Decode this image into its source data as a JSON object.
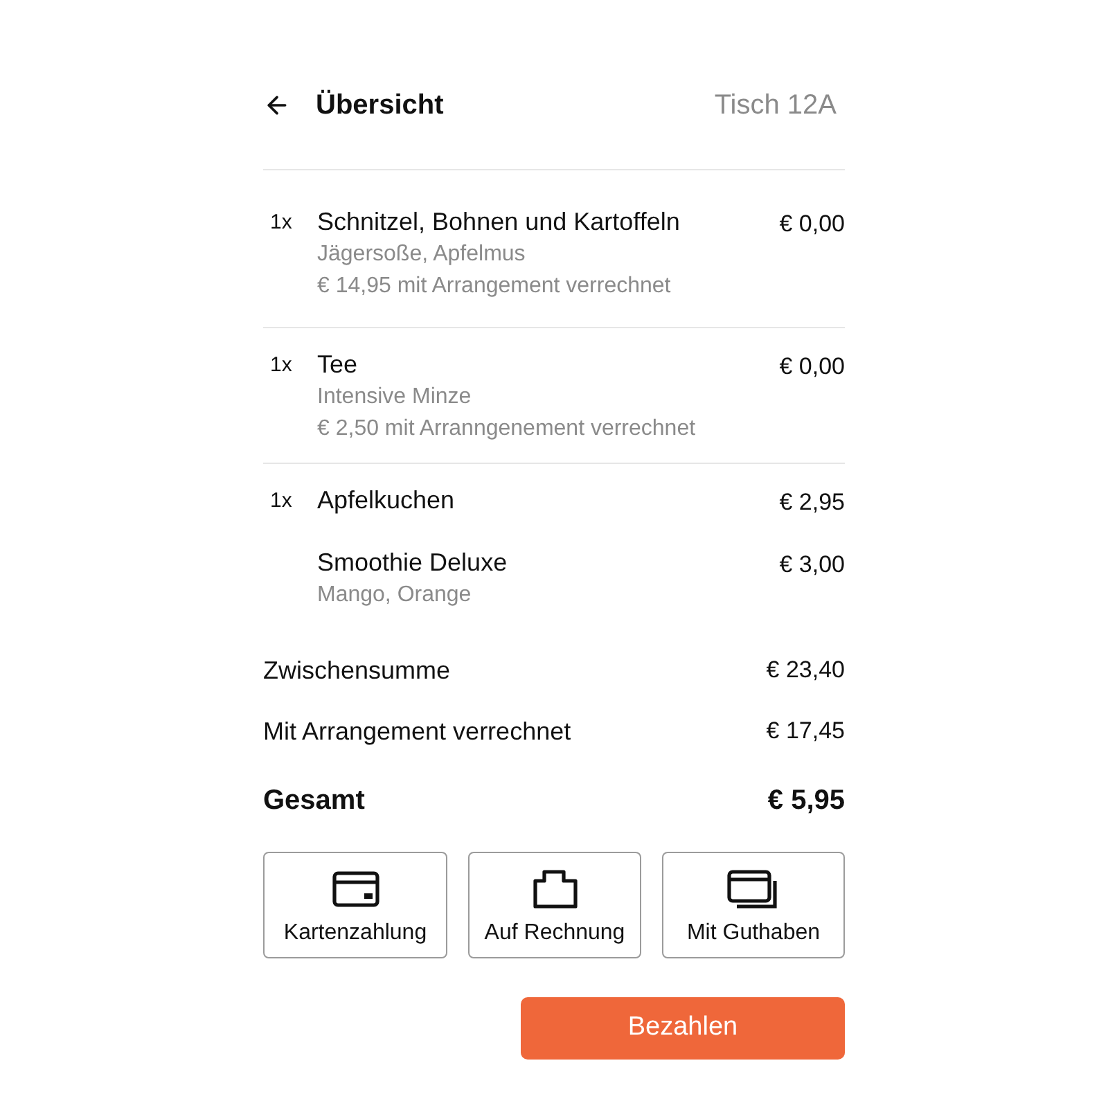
{
  "header": {
    "title": "Übersicht",
    "table": "Tisch 12A"
  },
  "groups": [
    {
      "lines": [
        {
          "qty": "1x",
          "name": "Schnitzel, Bohnen und Kartoffeln",
          "price": "€ 0,00",
          "details": [
            "Jägersoße, Apfelmus",
            "€ 14,95 mit Arrangement verrechnet"
          ]
        }
      ]
    },
    {
      "lines": [
        {
          "qty": "1x",
          "name": "Tee",
          "price": "€ 0,00",
          "details": [
            "Intensive Minze",
            "€ 2,50 mit Arranngenement verrechnet"
          ]
        }
      ]
    },
    {
      "lines": [
        {
          "qty": "1x",
          "name": "Apfelkuchen",
          "price": "€ 2,95"
        },
        {
          "name": "Smoothie Deluxe",
          "price": "€ 3,00",
          "details": [
            "Mango, Orange"
          ]
        }
      ]
    }
  ],
  "totals": [
    {
      "kind": "subtotal",
      "label": "Zwischensumme",
      "amount": "€ 23,40"
    },
    {
      "kind": "subtotal",
      "label": "Mit Arrangement verrechnet",
      "amount": "€ 17,45"
    },
    {
      "kind": "total",
      "label": "Gesamt",
      "amount": "€ 5,95"
    }
  ],
  "payment_options": [
    {
      "kind": "card",
      "label": "Kartenzahlung",
      "selected": false
    },
    {
      "kind": "invoice",
      "label": "Auf Rechnung",
      "selected": false
    },
    {
      "kind": "credit",
      "label": "Mit Guthaben",
      "selected": false
    }
  ],
  "pay_button": "Bezahlen"
}
